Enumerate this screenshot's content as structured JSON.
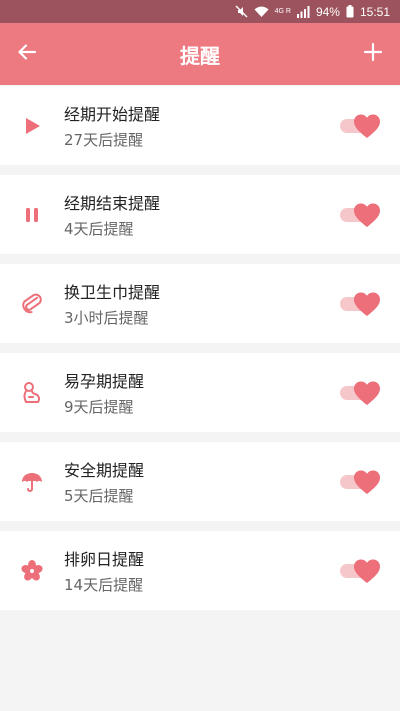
{
  "status_bar": {
    "network_label": "4G R",
    "battery": "94%",
    "time": "15:51"
  },
  "header": {
    "title": "提醒",
    "back_icon": "arrow-left-icon",
    "add_icon": "plus-icon"
  },
  "colors": {
    "status_bar": "#9c535d",
    "header": "#ee7a81",
    "accent": "#ec6f79",
    "toggle_track": "#f6c7ca",
    "background": "#f4f4f4"
  },
  "reminders": [
    {
      "title": "经期开始提醒",
      "subtitle": "27天后提醒",
      "icon": "play-icon",
      "enabled": true
    },
    {
      "title": "经期结束提醒",
      "subtitle": "4天后提醒",
      "icon": "pause-icon",
      "enabled": true
    },
    {
      "title": "换卫生巾提醒",
      "subtitle": "3小时后提醒",
      "icon": "paperclip-icon",
      "enabled": true
    },
    {
      "title": "易孕期提醒",
      "subtitle": "9天后提醒",
      "icon": "pregnant-woman-icon",
      "enabled": true
    },
    {
      "title": "安全期提醒",
      "subtitle": "5天后提醒",
      "icon": "umbrella-icon",
      "enabled": true
    },
    {
      "title": "排卵日提醒",
      "subtitle": "14天后提醒",
      "icon": "flower-icon",
      "enabled": true
    }
  ]
}
